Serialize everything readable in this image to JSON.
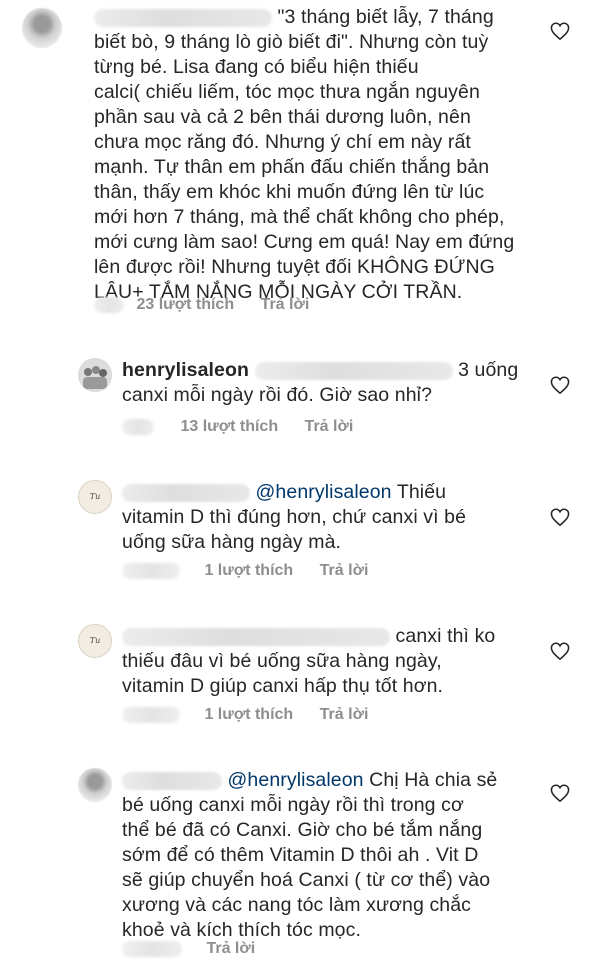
{
  "comments": [
    {
      "user": "",
      "mention": "",
      "lines": [
        "\"3 tháng biết lẫy, 7 tháng",
        "biết bò, 9 tháng lò giò biết đi\". Nhưng còn tuỳ",
        "từng bé. Lisa đang có biểu hiện thiếu",
        "calci( chiếu liếm, tóc mọc thưa ngắn nguyên",
        "phần sau và cả 2 bên thái dương luôn, nên",
        "chưa mọc răng đó. Nhưng ý chí em này rất",
        "mạnh. Tự thân em phấn đấu chiến thắng bản",
        "thân, thấy em khóc khi muốn đứng lên từ lúc",
        "mới hơn 7 tháng, mà thể chất không cho phép,",
        "mới cưng làm sao! Cưng em quá! Nay em đứng",
        "lên được rồi! Nhưng tuyệt đối KHÔNG ĐỨNG",
        "LÂU+ TẮM NẮNG MỖI NGÀY CỞI TRẦN."
      ],
      "likes": "23 lượt thích",
      "reply": "Trả lời"
    },
    {
      "user": "henrylisaleon",
      "first_tail": "3 uống",
      "lines": [
        "canxi mỗi ngày rồi đó. Giờ sao nhỉ?"
      ],
      "likes": "13 lượt thích",
      "reply": "Trả lời"
    },
    {
      "user": "",
      "mention": "@henrylisaleon",
      "first_tail": "Thiếu",
      "lines": [
        "vitamin D thì đúng hơn, chứ canxi vì bé",
        "uống sữa hàng ngày mà."
      ],
      "likes": "1 lượt thích",
      "reply": "Trả lời"
    },
    {
      "user": "",
      "first_tail": "canxi thì ko",
      "lines": [
        "thiếu đâu vì bé uống sữa hàng ngày,",
        "vitamin D giúp canxi hấp thụ tốt hơn."
      ],
      "likes": "1 lượt thích",
      "reply": "Trả lời"
    },
    {
      "user": "",
      "mention": "@henrylisaleon",
      "first_tail": "Chị Hà chia sẻ",
      "lines": [
        "bé uống canxi mỗi ngày rồi thì trong cơ",
        "thể bé đã có Canxi. Giờ cho bé tắm nắng",
        "sớm để có thêm Vitamin D thôi ah . Vit D",
        "sẽ giúp chuyển hoá Canxi ( từ cơ thể) vào",
        "xương và các nang tóc làm xương chắc",
        "khoẻ và kích thích tóc mọc."
      ],
      "reply": "Trả lời"
    }
  ],
  "logo_text": "Tu Anng",
  "colors": {
    "text": "#262626",
    "meta": "#8e8e8e",
    "mention": "#00376b"
  },
  "icons": {
    "like": "heart-outline-icon"
  }
}
